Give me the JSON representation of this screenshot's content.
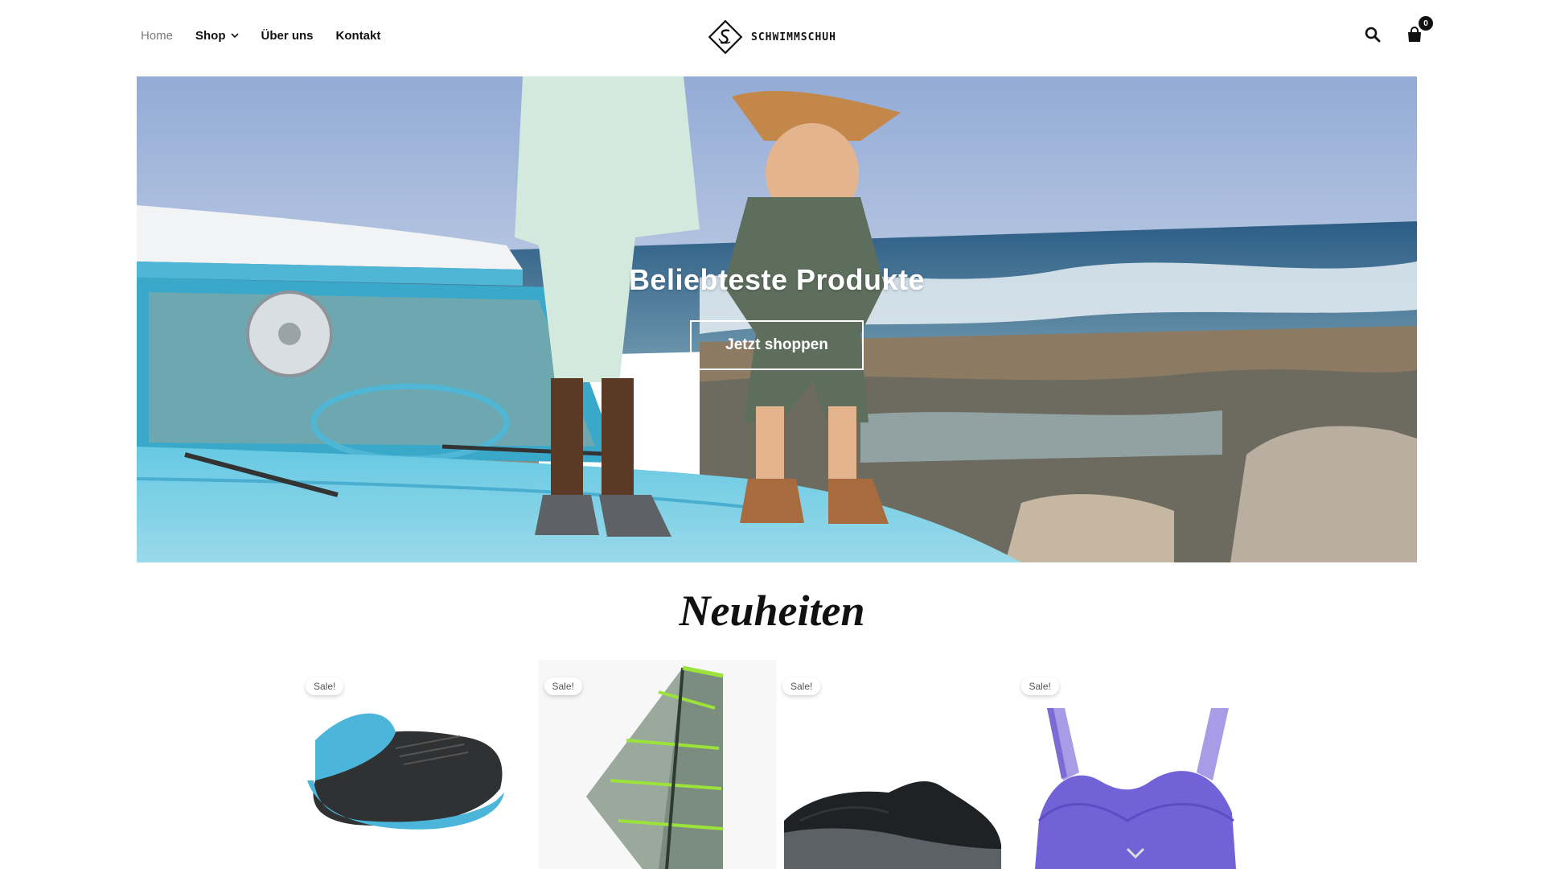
{
  "header": {
    "nav": [
      {
        "label": "Home"
      },
      {
        "label": "Shop"
      },
      {
        "label": "Über uns"
      },
      {
        "label": "Kontakt"
      }
    ],
    "logo_text": "SCHWIMMSCHUH",
    "cart_count": "0",
    "icons": [
      "search-icon",
      "cart-icon"
    ]
  },
  "hero": {
    "title": "Beliebteste Produkte",
    "button_label": "Jetzt shoppen"
  },
  "section": {
    "title": "Neuheiten"
  },
  "products": [
    {
      "badge": "Sale!",
      "image": "barefoot-shoe"
    },
    {
      "badge": "Sale!",
      "image": "windsurf-sail"
    },
    {
      "badge": "Sale!",
      "image": "running-shoe"
    },
    {
      "badge": "Sale!",
      "image": "sports-bra"
    }
  ],
  "colors": {
    "accent": "#111111",
    "hero_sky": "#7f9fd0",
    "car_blue": "#5fc4df",
    "sale_text": "#555555"
  }
}
